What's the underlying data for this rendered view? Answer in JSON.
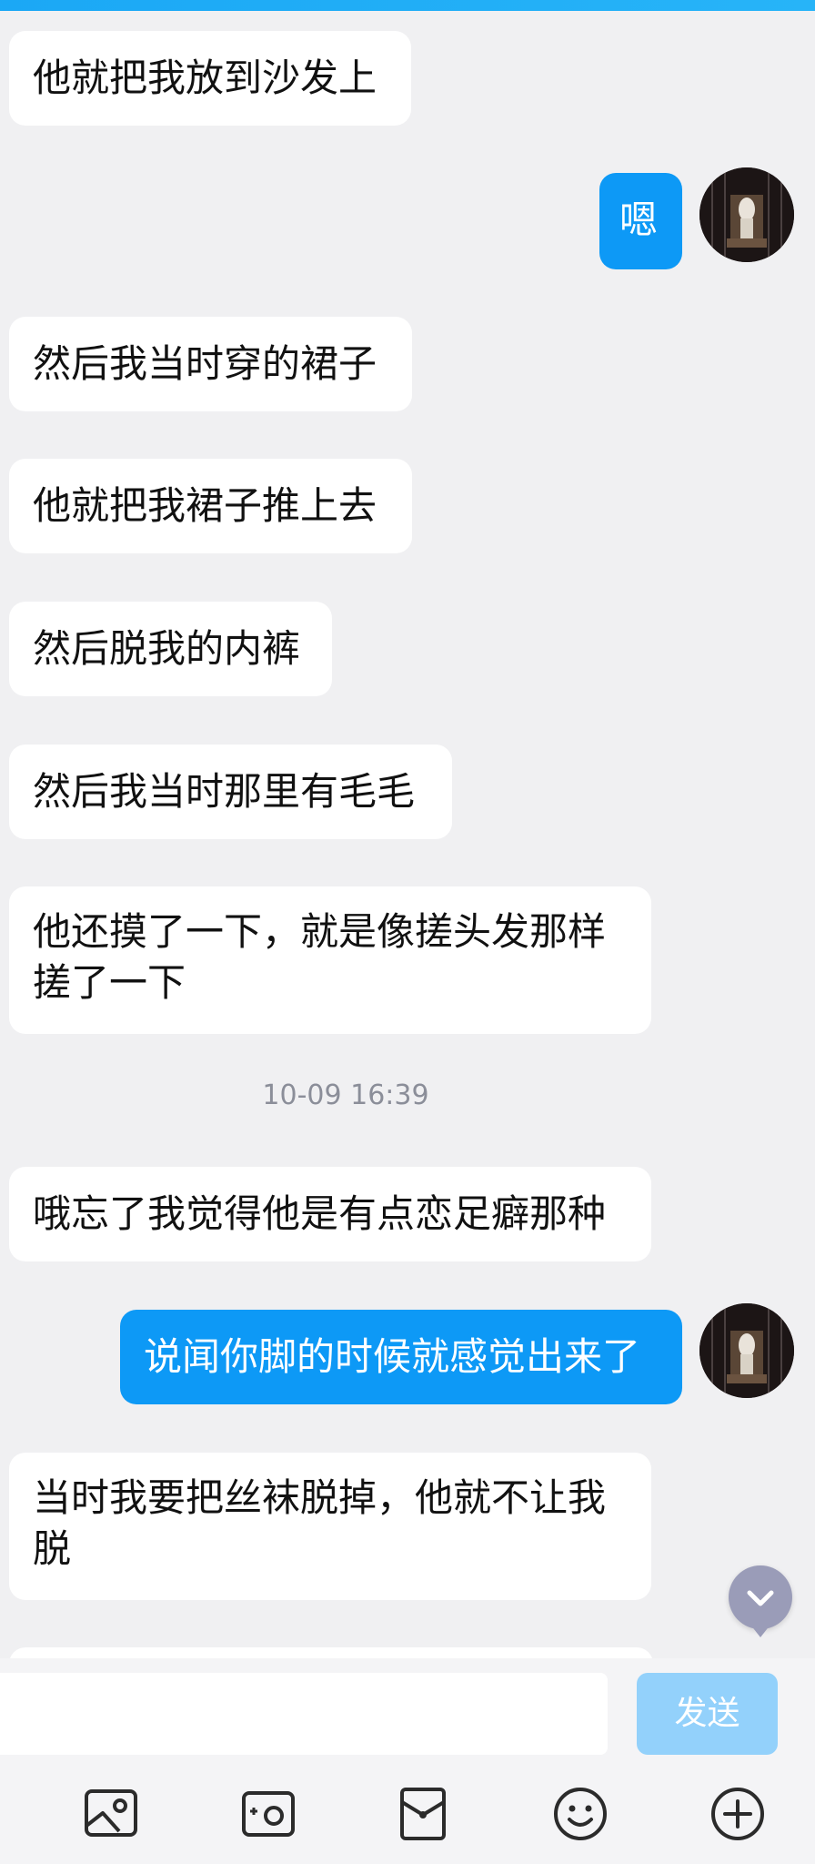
{
  "messages": [
    {
      "side": "in",
      "text": "他就把我放到沙发上"
    },
    {
      "side": "out",
      "text": "嗯"
    },
    {
      "side": "in",
      "text": "然后我当时穿的裙子"
    },
    {
      "side": "in",
      "text": "他就把我裙子推上去"
    },
    {
      "side": "in",
      "text": "然后脱我的内裤"
    },
    {
      "side": "in",
      "text": "然后我当时那里有毛毛"
    },
    {
      "side": "in",
      "text": "他还摸了一下，就是像搓头发那样搓了一下"
    },
    {
      "side": "in",
      "text": "哦忘了我觉得他是有点恋足癖那种"
    },
    {
      "side": "out",
      "text": "说闻你脚的时候就感觉出来了"
    },
    {
      "side": "in",
      "text": "当时我要把丝袜脱掉，他就不让我脱"
    }
  ],
  "timestamp": "10-09 16:39",
  "composer": {
    "input_value": "",
    "send_label": "发送"
  },
  "toolbar": {
    "icons": [
      "image-icon",
      "camera-icon",
      "red-packet-icon",
      "emoji-icon",
      "plus-icon"
    ]
  },
  "colors": {
    "outgoing_bubble": "#0d99f6",
    "incoming_bubble": "#ffffff",
    "background": "#f0f0f2",
    "send_disabled": "#93d1fb"
  }
}
